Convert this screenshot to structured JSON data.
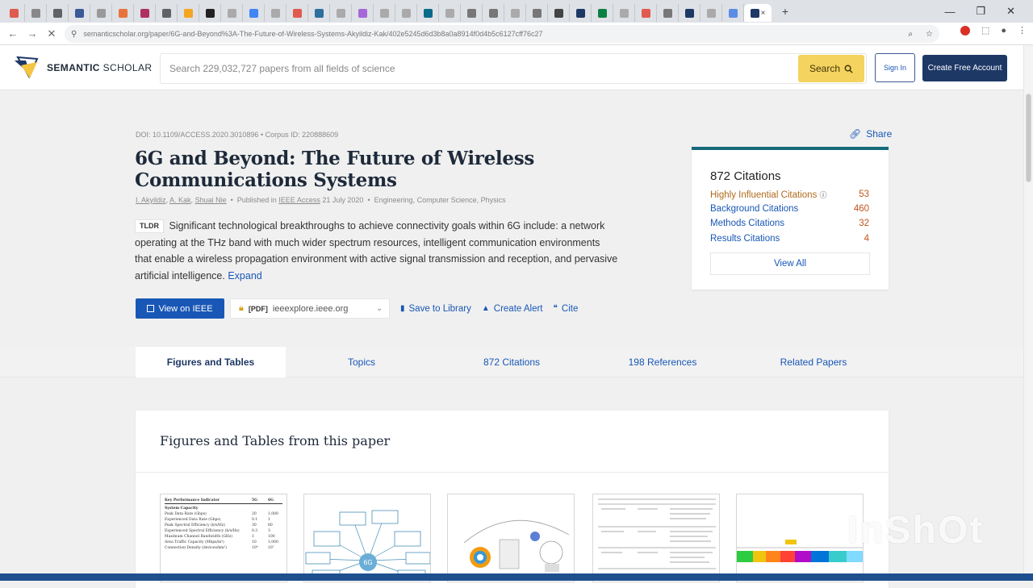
{
  "browser": {
    "tab_icon_colors": [
      "#e05a4f",
      "#888888",
      "#5f6368",
      "#3b5998",
      "#999999",
      "#e8743b",
      "#b03060",
      "#5f6368",
      "#f4a623",
      "#222222",
      "#aaaaaa",
      "#4285f4",
      "#aaaaaa",
      "#e05a4f",
      "#2f6f9f",
      "#aaaaaa",
      "#a668d8",
      "#aaaaaa",
      "#aaaaaa",
      "#0b6b8a",
      "#aaaaaa",
      "#777777",
      "#777777",
      "#aaaaaa",
      "#777777",
      "#444444",
      "#1e3866",
      "#0b8043",
      "#aaaaaa",
      "#e05a4f",
      "#777777",
      "#1e3866",
      "#aaaaaa",
      "#5a8ee6"
    ],
    "active_tab_close": "×",
    "new_tab": "+",
    "window_controls": {
      "minimize": "—",
      "maximize": "❐",
      "close": "✕"
    },
    "url": "semanticscholar.org/paper/6G-and-Beyond%3A-The-Future-of-Wireless-Systems-Akyildiz-Kak/402e5245d6d3b8a0a8914f0d4b5c6127cff76c27"
  },
  "header": {
    "brand_bold": "SEMANTIC",
    "brand_light": "SCHOLAR",
    "search_placeholder": "Search 229,032,727 papers from all fields of science",
    "search_button": "Search",
    "sign_in": "Sign In",
    "create_account": "Create Free Account"
  },
  "paper": {
    "meta": "DOI: 10.1109/ACCESS.2020.3010896 • Corpus ID: 220888609",
    "title": "6G and Beyond: The Future of Wireless Communications Systems",
    "authors": [
      {
        "name": "I. Akyildiz"
      },
      {
        "name": "A. Kak"
      },
      {
        "name": "Shuai Nie"
      }
    ],
    "published_prefix": "Published in",
    "venue": "IEEE Access",
    "date": "21 July 2020",
    "fields": "Engineering, Computer Science, Physics",
    "tldr_tag": "TLDR",
    "tldr": "Significant technological breakthroughs to achieve connectivity goals within 6G include: a network operating at the THz band with much wider spectrum resources, intelligent communication environments that enable a wireless propagation environment with active signal transmission and reception, and pervasive artificial intelligence.",
    "expand": "Expand"
  },
  "actions": {
    "view_ieee": "View on IEEE",
    "source_tag": "[PDF]",
    "source_domain": "ieeexplore.ieee.org",
    "save": "Save to Library",
    "alert": "Create Alert",
    "cite": "Cite",
    "share": "Share"
  },
  "citations": {
    "heading": "872 Citations",
    "rows": [
      {
        "label": "Highly Influential Citations",
        "value": "53"
      },
      {
        "label": "Background Citations",
        "value": "460"
      },
      {
        "label": "Methods Citations",
        "value": "32"
      },
      {
        "label": "Results Citations",
        "value": "4"
      }
    ],
    "view_all": "View All"
  },
  "tabs": [
    "Figures and Tables",
    "Topics",
    "872 Citations",
    "198 References",
    "Related Papers"
  ],
  "figures": {
    "heading": "Figures and Tables from this paper",
    "table1": {
      "title": "Key Performance Indicator",
      "cols": [
        "5G",
        "6G"
      ],
      "section": "System Capacity",
      "rows": [
        {
          "k": "Peak Data Rate (Gbps)",
          "a": "20",
          "b": "1,000"
        },
        {
          "k": "Experienced Data Rate (Gbps)",
          "a": "0.1",
          "b": "1"
        },
        {
          "k": "Peak Spectral Efficiency (b/s/Hz)",
          "a": "30",
          "b": "60"
        },
        {
          "k": "Experienced Spectral Efficiency (b/s/Hz)",
          "a": "0.3",
          "b": "3"
        },
        {
          "k": "Maximum Channel Bandwidth (GHz)",
          "a": "1",
          "b": "100"
        },
        {
          "k": "Area Traffic Capacity (Mbps/m²)",
          "a": "10",
          "b": "1,000"
        },
        {
          "k": "Connection Density (devices/km²)",
          "a": "10⁶",
          "b": "10⁷"
        }
      ]
    },
    "diagram_center": "6G"
  },
  "watermark": "InShOt"
}
